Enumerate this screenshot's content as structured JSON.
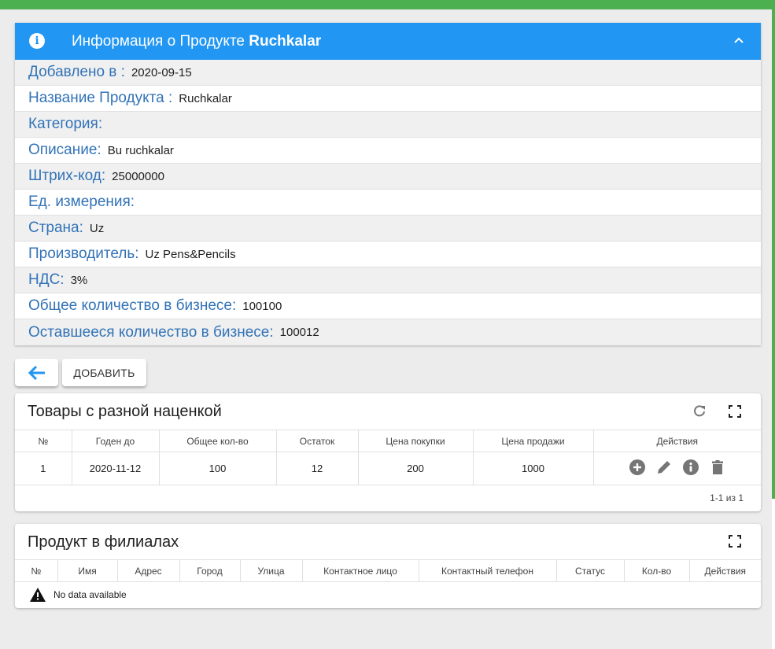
{
  "info": {
    "title_prefix": "Информация о Продукте",
    "title_product": "Ruchkalar",
    "rows": [
      {
        "label": "Добавлено в :",
        "value": "2020-09-15"
      },
      {
        "label": "Название Продукта :",
        "value": "Ruchkalar"
      },
      {
        "label": "Категория:",
        "value": ""
      },
      {
        "label": "Описание:",
        "value": "Bu ruchkalar"
      },
      {
        "label": "Штрих-код:",
        "value": "25000000"
      },
      {
        "label": "Ед. измерения:",
        "value": ""
      },
      {
        "label": "Страна:",
        "value": "Uz"
      },
      {
        "label": "Производитель:",
        "value": "Uz Pens&Pencils"
      },
      {
        "label": "НДС:",
        "value": "3%"
      },
      {
        "label": "Общее количество в бизнесе:",
        "value": "100100"
      },
      {
        "label": "Оставшееся количество в бизнесе:",
        "value": "100012"
      }
    ]
  },
  "buttons": {
    "add_label": "ДОБАВИТЬ"
  },
  "markup_table": {
    "title": "Товары с разной наценкой",
    "headers": [
      "№",
      "Годен до",
      "Общее кол-во",
      "Остаток",
      "Цена покупки",
      "Цена продажи",
      "Действия"
    ],
    "rows": [
      [
        "1",
        "2020-11-12",
        "100",
        "12",
        "200",
        "1000"
      ]
    ],
    "pagination": "1-1 из 1"
  },
  "branches_table": {
    "title": "Продукт в филиалах",
    "headers": [
      "№",
      "Имя",
      "Адрес",
      "Город",
      "Улица",
      "Контактное лицо",
      "Контактный телефон",
      "Статус",
      "Кол-во",
      "Действия"
    ],
    "empty_text": "No data available"
  },
  "colors": {
    "header_blue": "#2196f3",
    "label_blue": "#3273b7",
    "accent_green": "#4caf50"
  }
}
